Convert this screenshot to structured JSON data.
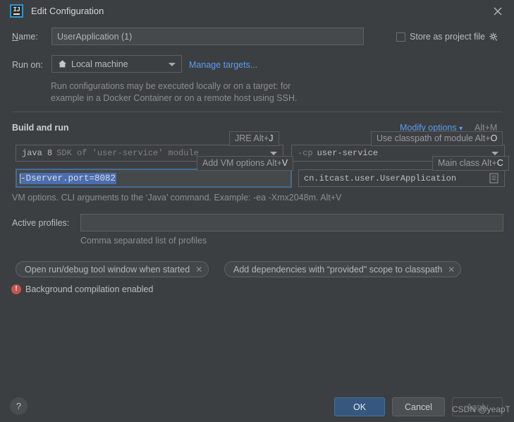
{
  "window": {
    "title": "Edit Configuration",
    "app_icon": "intellij-idea-icon",
    "close_icon": "close-icon"
  },
  "name_row": {
    "label": "Name:",
    "label_mnemonic": "N",
    "label_rest": "ame:",
    "value": "UserApplication (1)"
  },
  "store_as_project_file": {
    "label_mnemonic": "S",
    "label_rest": "tore as project file",
    "label": "Store as project file",
    "checked": false,
    "gear_icon": "gear-icon"
  },
  "run_on": {
    "label": "Run on:",
    "selected": "Local machine",
    "home_icon": "home-icon",
    "manage_targets_link": "Manage targets..."
  },
  "description": {
    "line1": "Run configurations may be executed locally or on a target: for",
    "line2": "example in a Docker Container or on a remote host using SSH."
  },
  "build_and_run": {
    "section_title": "Build and run",
    "modify_options_link": "Modify options",
    "modify_options_shortcut": "Alt+M",
    "jre": {
      "prefix": "java 8",
      "suffix": "SDK of 'user-service' module",
      "full": "java 8 SDK of 'user-service' module",
      "hint": "JRE Alt+J",
      "hint_text": "JRE Alt+",
      "hint_key": "J"
    },
    "classpath": {
      "prefix": "-cp",
      "value": "user-service",
      "hint_text": "Use classpath of module Alt+",
      "hint_key": "O"
    },
    "vm_options": {
      "value": "-Dserver.port=8082",
      "selected": true,
      "hint_text": "Add VM options Alt+",
      "hint_key": "V",
      "expand_icon": "expand-icon",
      "list_icon": "document-list-icon",
      "help": "VM options. CLI arguments to the ‘Java’ command. Example: -ea -Xmx2048m. Alt+V"
    },
    "main_class": {
      "value": "cn.itcast.user.UserApplication",
      "hint_text": "Main class Alt+",
      "hint_key": "C",
      "browse_icon": "document-list-icon"
    }
  },
  "active_profiles": {
    "label": "Active profiles:",
    "value": "",
    "help": "Comma separated list of profiles"
  },
  "chips": [
    {
      "label": "Open run/debug tool window when started",
      "close_icon": "close-icon"
    },
    {
      "label": "Add dependencies with “provided\" scope to classpath",
      "close_icon": "close-icon"
    }
  ],
  "status": {
    "icon": "error-icon",
    "text": "Background compilation enabled"
  },
  "footer": {
    "help_label": "?",
    "ok": "OK",
    "cancel": "Cancel",
    "apply": "Apply",
    "apply_disabled": true
  },
  "watermark": "CSDN @yeapT",
  "colors": {
    "dialog_bg": "#3c3f41",
    "field_bg": "#45494a",
    "accent_link": "#589df6",
    "primary_button": "#365880",
    "selection": "#4b6eaf",
    "error": "#c75450",
    "focus_border": "#466d94"
  }
}
